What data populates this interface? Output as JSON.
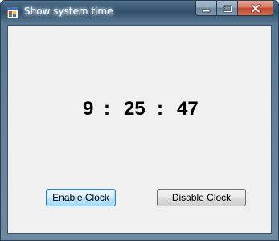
{
  "window": {
    "title": "Show system time",
    "controls": {
      "minimize": "minimize-icon",
      "maximize": "maximize-icon",
      "close": "close-icon"
    }
  },
  "clock": {
    "hours": "9",
    "separator1": ":",
    "minutes": "25",
    "separator2": ":",
    "seconds": "47"
  },
  "buttons": {
    "enable_label": "Enable Clock",
    "disable_label": "Disable Clock"
  },
  "colors": {
    "title_bar": "#2f4f6b",
    "client_background": "#f0f0f0",
    "close_button": "#c24a30",
    "focus_border": "#3c7fb1"
  }
}
